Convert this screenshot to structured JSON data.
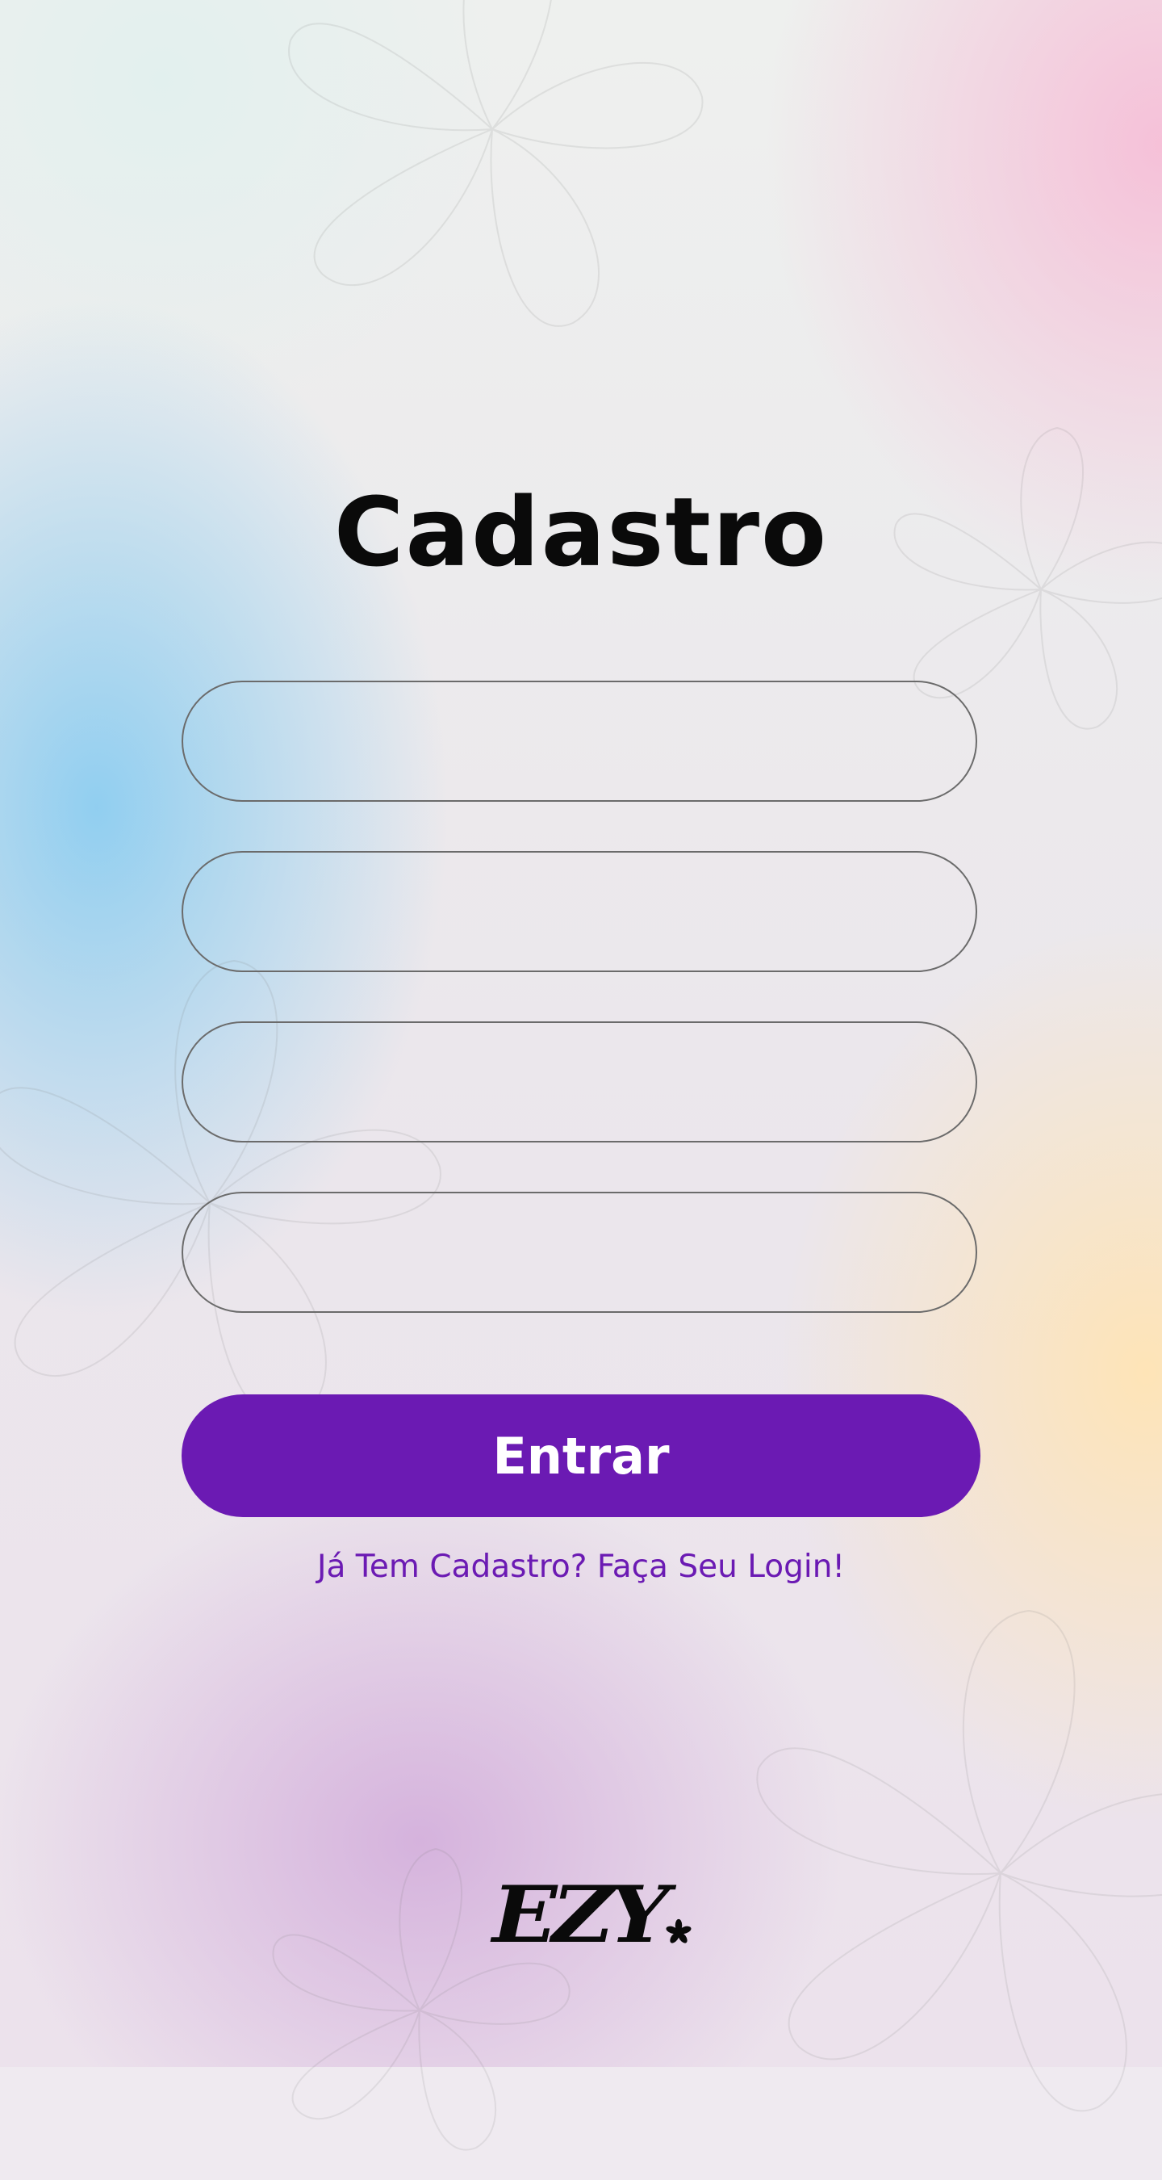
{
  "page": {
    "title": "Cadastro"
  },
  "form": {
    "fields": [
      {
        "value": "",
        "placeholder": ""
      },
      {
        "value": "",
        "placeholder": ""
      },
      {
        "value": "",
        "placeholder": ""
      },
      {
        "value": "",
        "placeholder": ""
      }
    ],
    "submit_label": "Entrar",
    "login_link": "Já Tem Cadastro? Faça Seu Login!"
  },
  "brand": {
    "logo_text": "EZY",
    "logo_icon": "asterisk-flower-icon"
  },
  "colors": {
    "accent": "#6b1ab3",
    "title": "#0a0a0a",
    "field_border": "#6b6b6b"
  },
  "icons": {
    "background_decoration": "flower-outline-icon"
  }
}
